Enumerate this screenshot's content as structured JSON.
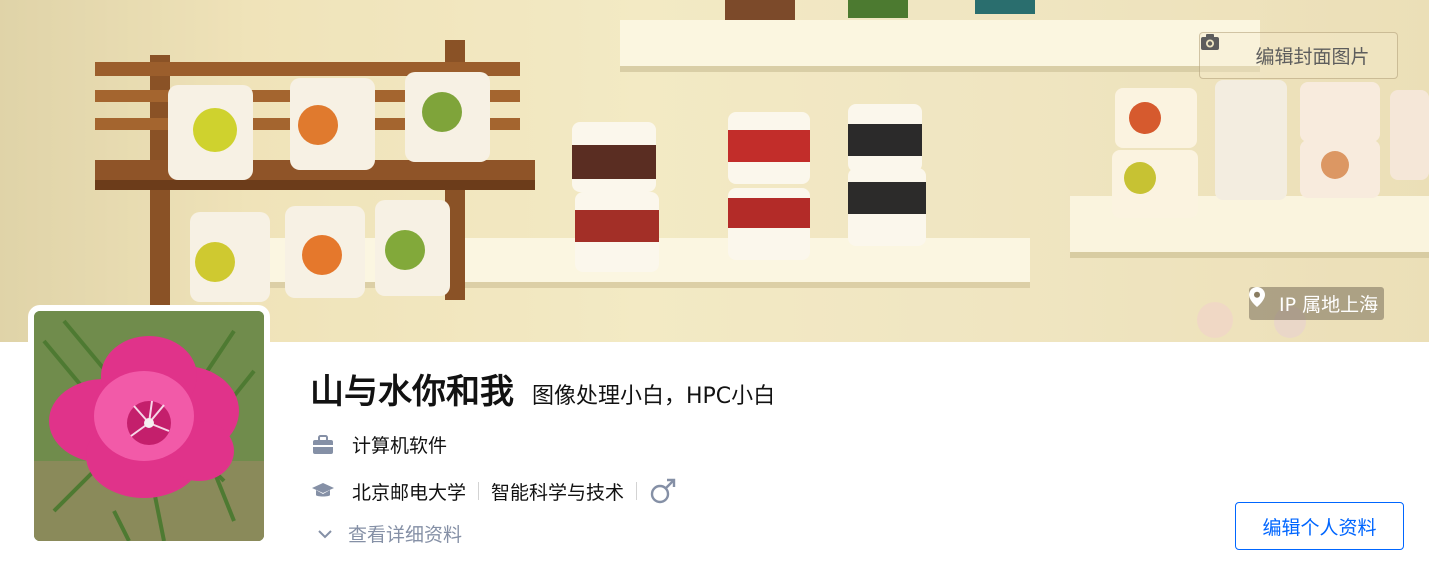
{
  "cover": {
    "edit_cover_label": "编辑封面图片",
    "ip_location": "IP 属地上海",
    "camera_icon": "camera-icon",
    "location_icon": "location-pin-icon"
  },
  "profile": {
    "name": "山与水你和我",
    "headline": "图像处理小白，HPC小白",
    "industry": "计算机软件",
    "school": "北京邮电大学",
    "major": "智能科学与技术",
    "gender": "male",
    "view_details": "查看详细资料",
    "edit_profile": "编辑个人资料"
  },
  "icons": {
    "industry": "briefcase-icon",
    "education": "graduation-cap-icon",
    "gender": "male-icon",
    "expand": "chevron-down-icon"
  },
  "colors": {
    "accent": "#0066ff",
    "muted": "#8590a6",
    "icon_gray": "#8590a6"
  }
}
